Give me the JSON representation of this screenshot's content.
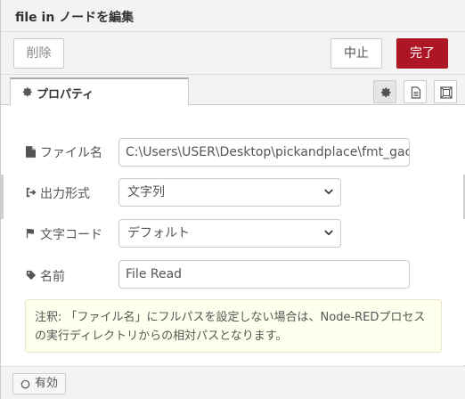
{
  "header": {
    "title": "file in ノードを編集"
  },
  "buttons": {
    "delete": "削除",
    "cancel": "中止",
    "done": "完了"
  },
  "tabs": [
    {
      "label": "プロパティ",
      "icon": "gear-icon"
    }
  ],
  "tab_icons": [
    "gear-icon",
    "document-icon",
    "frame-icon"
  ],
  "form": {
    "filename": {
      "label": "ファイル名",
      "icon": "file-icon",
      "value": "C:\\Users\\USER\\Desktop\\pickandplace\\fmt_gachaC"
    },
    "format": {
      "label": "出力形式",
      "icon": "sign-out-icon",
      "value": "文字列"
    },
    "encoding": {
      "label": "文字コード",
      "icon": "flag-icon",
      "value": "デフォルト"
    },
    "name": {
      "label": "名前",
      "icon": "tag-icon",
      "value": "File Read"
    }
  },
  "note": {
    "text": "注釈: 「ファイル名」にフルパスを設定しない場合は、Node-REDプロセスの実行ディレクトリからの相対パスとなります。"
  },
  "footer": {
    "toggle_label": "有効"
  },
  "colors": {
    "done_button": "#ad1625",
    "note_bg": "#ffffed",
    "header_bg": "#f3f3f3"
  }
}
